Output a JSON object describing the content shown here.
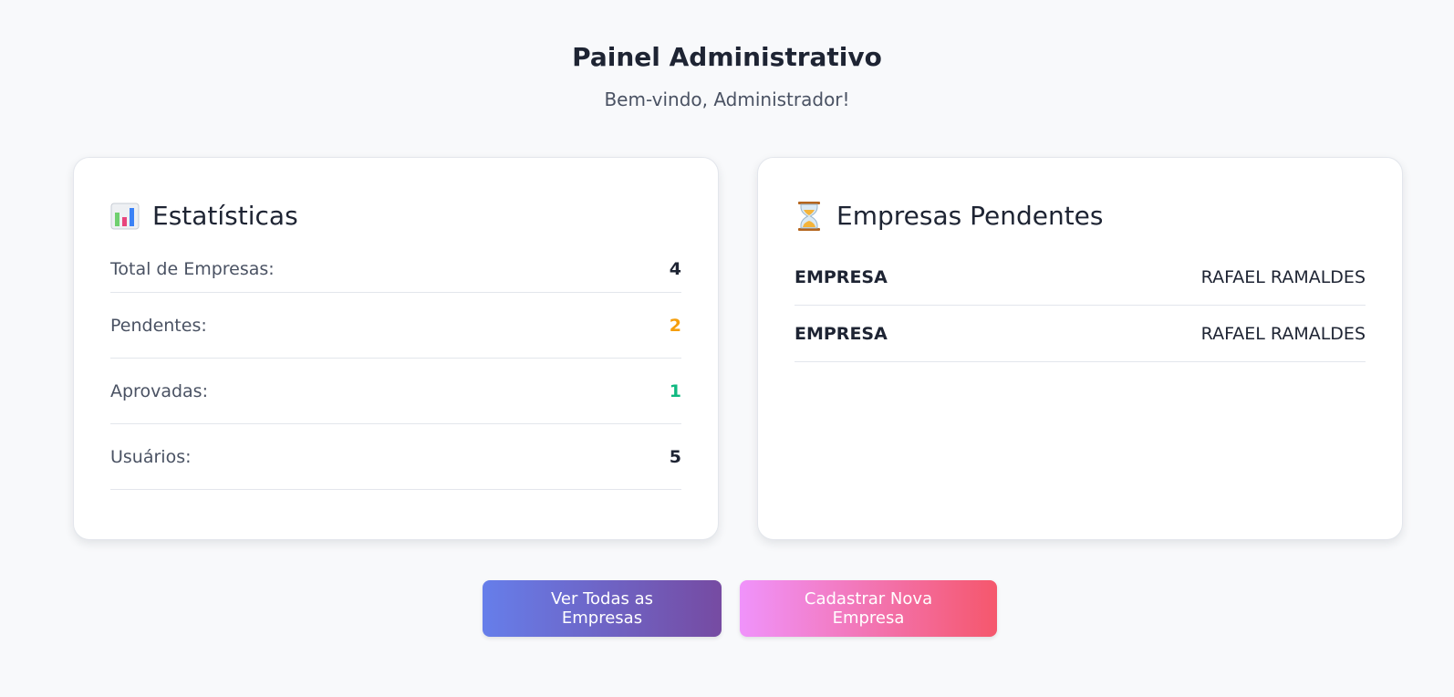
{
  "header": {
    "title": "Painel Administrativo",
    "subtitle": "Bem-vindo, Administrador!"
  },
  "stats_card": {
    "icon": "bar-chart-icon",
    "title": "Estatísticas",
    "rows": [
      {
        "label": "Total de Empresas:",
        "value": "4",
        "color": "#1e2433"
      },
      {
        "label": "Pendentes:",
        "value": "2",
        "color": "#f59e0b"
      },
      {
        "label": "Aprovadas:",
        "value": "1",
        "color": "#10b981"
      },
      {
        "label": "Usuários:",
        "value": "5",
        "color": "#1e2433"
      }
    ]
  },
  "pending_card": {
    "icon": "hourglass-icon",
    "title": "Empresas Pendentes",
    "items": [
      {
        "company": "EMPRESA",
        "owner": "RAFAEL RAMALDES"
      },
      {
        "company": "EMPRESA",
        "owner": "RAFAEL RAMALDES"
      }
    ]
  },
  "actions": {
    "view_all_label": "Ver Todas as Empresas",
    "register_label": "Cadastrar Nova Empresa"
  },
  "colors": {
    "pending": "#f59e0b",
    "approved": "#10b981",
    "primary_gradient": [
      "#667eea",
      "#764ba2"
    ],
    "secondary_gradient": [
      "#f093fb",
      "#f5576c"
    ]
  }
}
